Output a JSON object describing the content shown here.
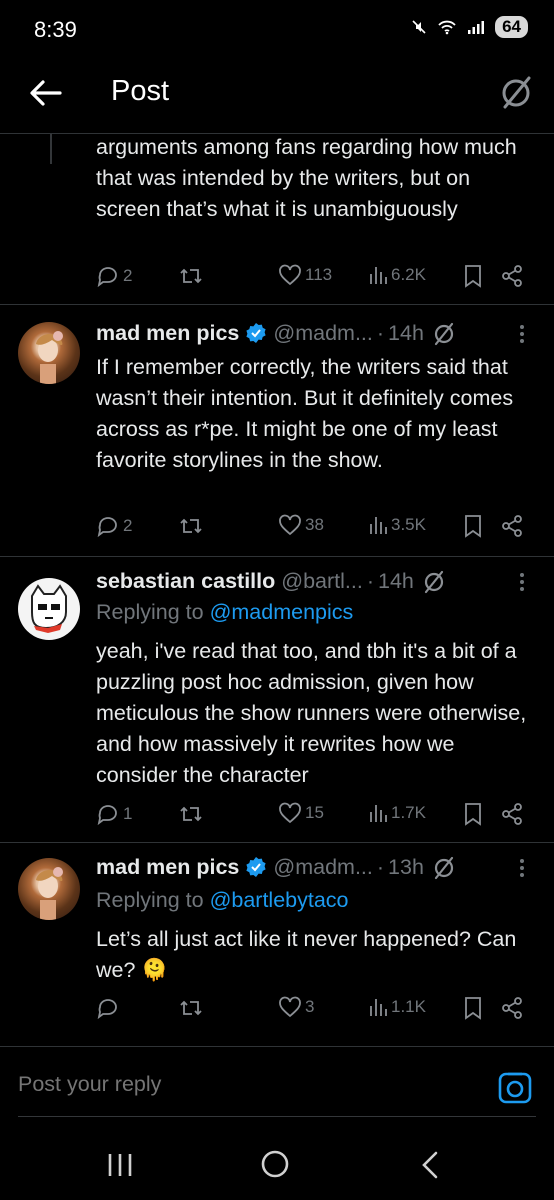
{
  "status_bar": {
    "time": "8:39",
    "battery": "64"
  },
  "header": {
    "title": "Post"
  },
  "thread_tail": {
    "text": "arguments among fans regarding how much that was intended by the writers, but on screen that’s what it is unambiguously",
    "replies": "2",
    "likes": "113",
    "views": "6.2K"
  },
  "tweets": [
    {
      "name": "mad men pics",
      "handle": "@madm...",
      "time": "14h",
      "replying_to": "",
      "text": "If I remember correctly, the writers said that wasn’t their intention. But it definitely comes across as r*pe. It might be one of my least favorite storylines in the show.",
      "replies": "2",
      "likes": "38",
      "views": "3.5K"
    },
    {
      "name": "sebastian castillo",
      "handle": "@bartl...",
      "time": "14h",
      "replying_label": "Replying to",
      "replying_to": "@madmenpics",
      "text": "yeah, i've read that too, and tbh it's a bit of a puzzling post hoc admission, given how meticulous the show runners were otherwise, and how massively it rewrites how we consider the character",
      "replies": "1",
      "likes": "15",
      "views": "1.7K"
    },
    {
      "name": "mad men pics",
      "handle": "@madm...",
      "time": "13h",
      "replying_label": "Replying to",
      "replying_to": "@bartlebytaco",
      "text": "Let’s all just act like it never happened? Can we? 🫠",
      "replies": "",
      "likes": "3",
      "views": "1.1K"
    }
  ],
  "composer": {
    "placeholder": "Post your reply"
  },
  "colors": {
    "background": "#000000",
    "text": "#e7e9ea",
    "muted": "#71767b",
    "accent": "#1d9bf0",
    "divider": "#2f3336"
  },
  "icons": [
    "back-arrow-icon",
    "grok-icon",
    "reply-icon",
    "repost-icon",
    "like-icon",
    "views-icon",
    "bookmark-icon",
    "share-icon",
    "verified-icon",
    "more-icon",
    "camera-icon",
    "recents-icon",
    "home-icon",
    "nav-back-icon"
  ]
}
